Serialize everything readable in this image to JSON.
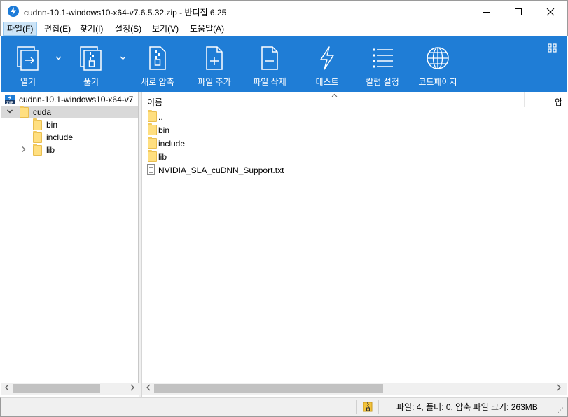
{
  "window": {
    "title": "cudnn-10.1-windows10-x64-v7.6.5.32.zip - 반디집 6.25"
  },
  "menu": {
    "items": [
      "파일(F)",
      "편집(E)",
      "찾기(I)",
      "설정(S)",
      "보기(V)",
      "도움말(A)"
    ]
  },
  "toolbar": {
    "open_label": "열기",
    "extract_label": "풀기",
    "new_archive_label": "새로 압축",
    "add_files_label": "파일 추가",
    "delete_files_label": "파일 삭제",
    "test_label": "테스트",
    "columns_label": "칼럼 설정",
    "codepage_label": "코드페이지"
  },
  "tree": {
    "root": "cudnn-10.1-windows10-x64-v7",
    "items": [
      "cuda",
      "bin",
      "include",
      "lib"
    ]
  },
  "list": {
    "column_name": "이름",
    "column_compressed": "압",
    "files": [
      "..",
      "bin",
      "include",
      "lib",
      "NVIDIA_SLA_cuDNN_Support.txt"
    ]
  },
  "status": {
    "text": "파일: 4, 폴더: 0, 압축 파일 크기: 263MB"
  },
  "colors": {
    "toolbar_bg": "#1f7dd6",
    "selection_bg": "#d9d9d9",
    "menu_active_bg": "#cce4f7",
    "folder_fill": "#ffdf80"
  },
  "icons": [
    "bandizip-app-icon",
    "minimize-icon",
    "maximize-icon",
    "close-icon",
    "open-icon",
    "extract-icon",
    "new-archive-icon",
    "add-file-icon",
    "delete-file-icon",
    "test-icon",
    "columns-icon",
    "codepage-icon",
    "layout-icon",
    "zip-icon",
    "folder-icon",
    "text-file-icon"
  ]
}
